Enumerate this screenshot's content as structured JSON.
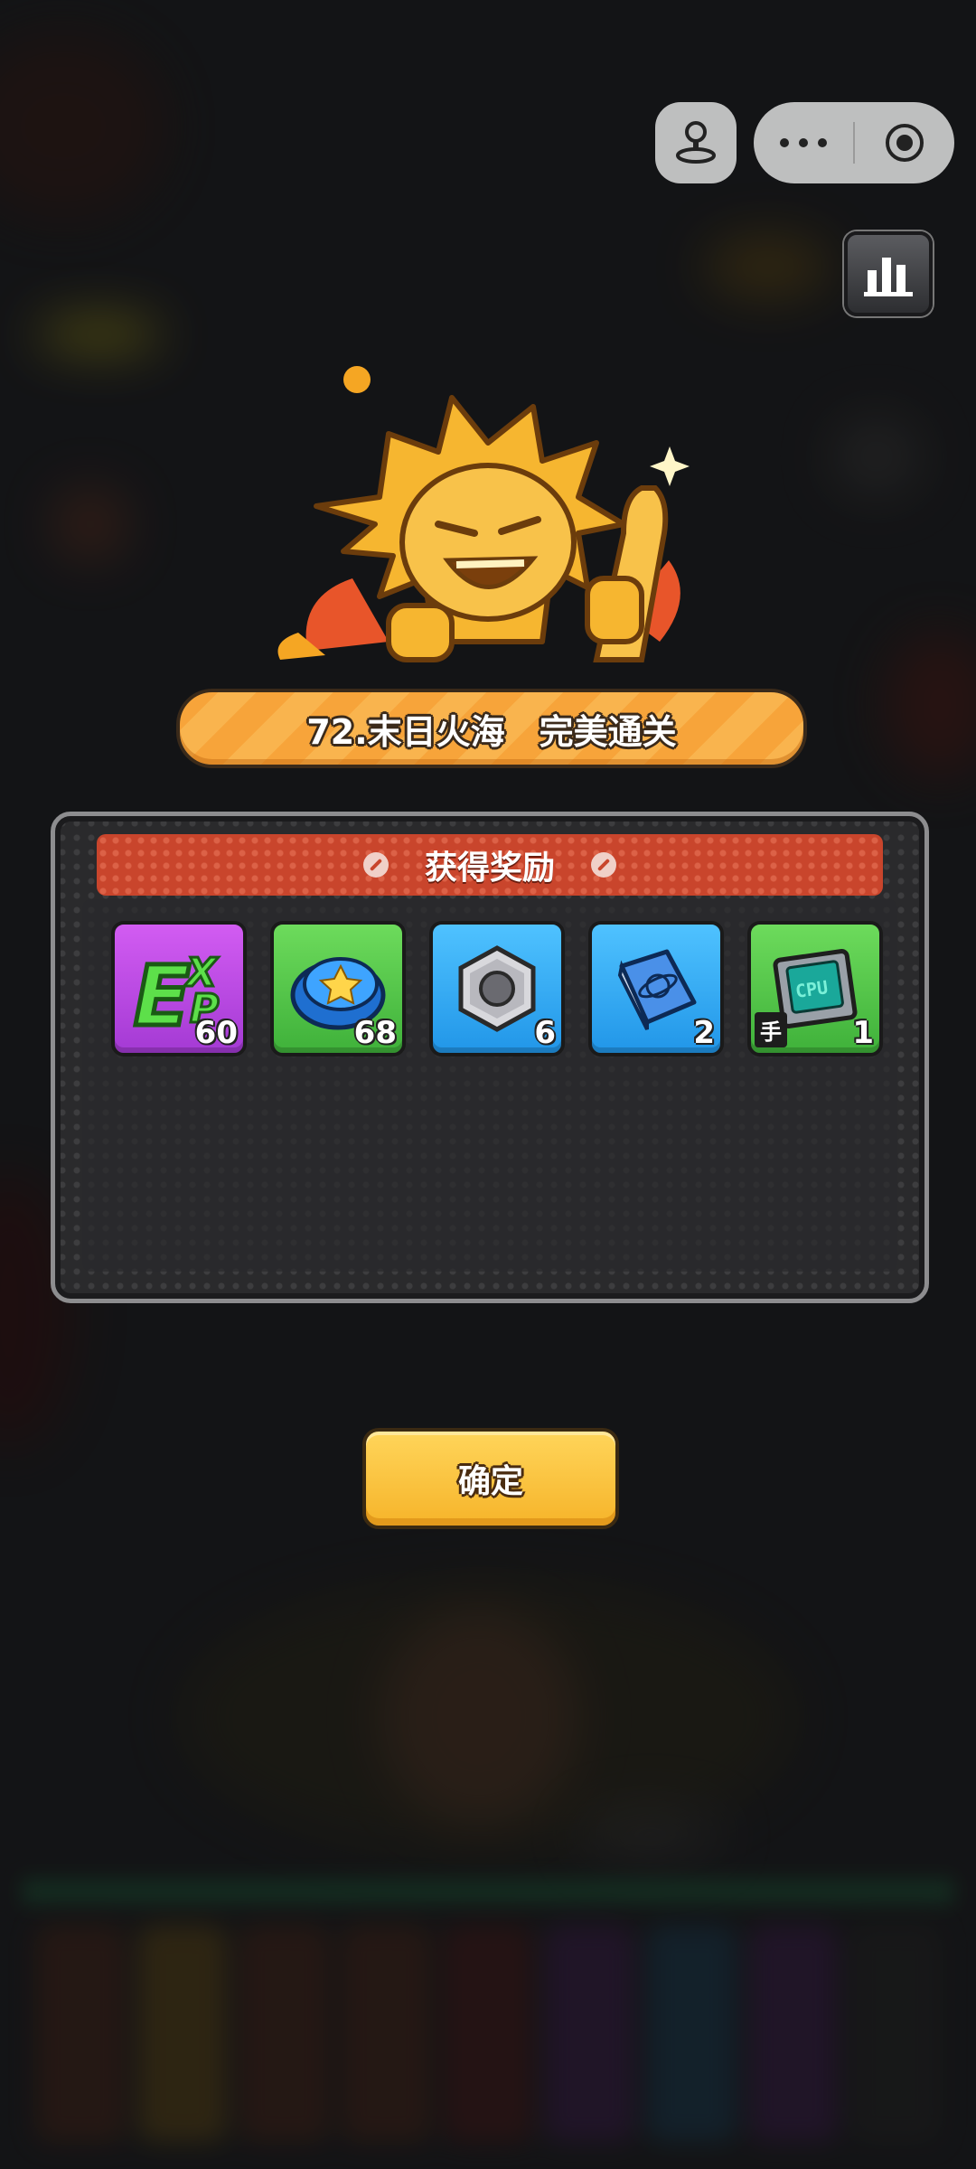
{
  "title_banner": {
    "level": "72.末日火海",
    "result": "完美通关"
  },
  "reward_panel": {
    "header": "获得奖励",
    "items": [
      {
        "name": "exp",
        "count": "60",
        "color": "#b94ee0",
        "icon": "exp-icon"
      },
      {
        "name": "bottle-cap",
        "count": "68",
        "color": "#52c448",
        "icon": "bottle-cap-icon"
      },
      {
        "name": "hex-nut",
        "count": "6",
        "color": "#34abf5",
        "icon": "hex-nut-icon"
      },
      {
        "name": "blueprint-book",
        "count": "2",
        "color": "#34abf5",
        "icon": "book-icon"
      },
      {
        "name": "cpu-chip",
        "count": "1",
        "tag": "手",
        "color": "#52c448",
        "icon": "cpu-chip-icon"
      }
    ]
  },
  "confirm": {
    "label": "确定"
  },
  "top_controls": {
    "joystick": "joystick-icon",
    "more": "more-dots-icon",
    "close": "target-circle-icon",
    "stats": "bar-chart-icon"
  }
}
